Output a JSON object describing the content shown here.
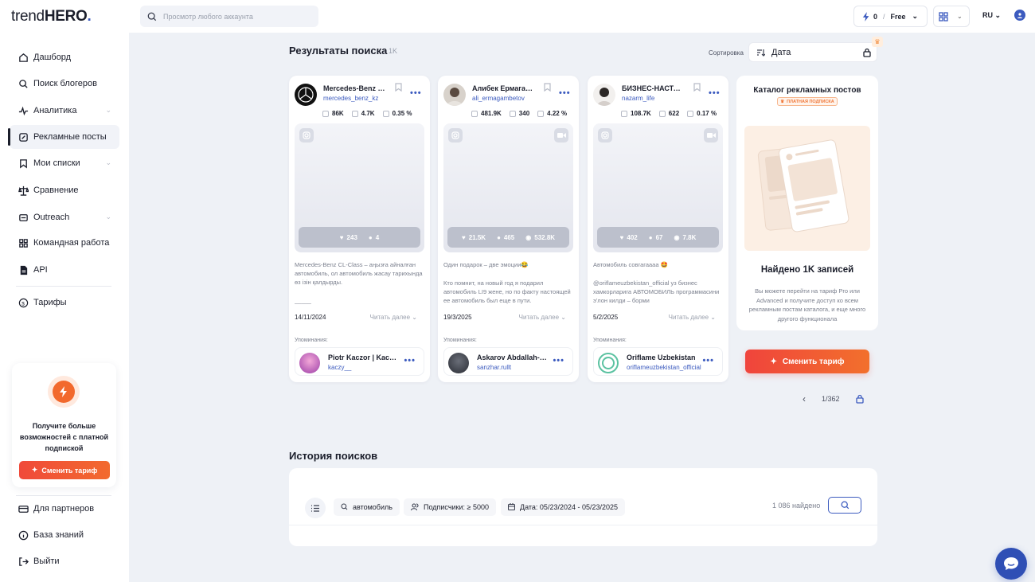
{
  "brand": {
    "prefix": "trend",
    "suffix": "HERO",
    "accent": "#3c5bbf",
    "cta": "#f04a3a"
  },
  "nav": [
    {
      "label": "Дашборд",
      "icon": "home-icon"
    },
    {
      "label": "Поиск блогеров",
      "icon": "search-icon"
    },
    {
      "label": "Аналитика",
      "icon": "analytics-icon"
    },
    {
      "label": "Рекламные посты",
      "icon": "ad-post-icon"
    },
    {
      "label": "Мои списки",
      "icon": "bookmark-icon"
    },
    {
      "label": "Сравнение",
      "icon": "scales-icon"
    },
    {
      "label": "Outreach",
      "icon": "outreach-icon"
    },
    {
      "label": "Командная работа",
      "icon": "grid-icon"
    },
    {
      "label": "API",
      "icon": "document-icon"
    },
    {
      "label": "Тарифы",
      "icon": "dollar-icon"
    }
  ],
  "promo": {
    "text": "Получите больше возможностей с платной подпиской",
    "button": "Сменить тариф"
  },
  "bottom_nav": [
    {
      "label": "Для партнеров",
      "icon": "card-icon"
    },
    {
      "label": "База знаний",
      "icon": "info-icon"
    },
    {
      "label": "Выйти",
      "icon": "logout-icon"
    }
  ],
  "topbar": {
    "search_placeholder": "Просмотр любого аккаунта",
    "credits": "0",
    "sep": "/",
    "plan": "Free",
    "lang": "RU"
  },
  "results": {
    "title": "Результаты поиска",
    "count": "1K",
    "sort_label": "Сортировка",
    "sort_value": "Дата"
  },
  "cards": [
    {
      "name": "Mercedes-Benz Kazakhstan",
      "handle": "mercedes_benz_kz",
      "followers": "86K",
      "posts": "4.7K",
      "er": "0.35 %",
      "likes": "243",
      "comments": "4",
      "views": "",
      "video": false,
      "desc": "Mercedes-Benz CL-Class – аңызға айналған автомобиль, ол автомобиль жасау тарихында өз ізін қалдырды.",
      "desc_extra": "_____",
      "date": "14/11/2024",
      "read_more": "Читать далее",
      "mention_label": "Упоминания:",
      "mention_name": "Piotr Kaczor | Kaczy __",
      "mention_handle": "kaczy__"
    },
    {
      "name": "Алибек Ермагамбетов",
      "handle": "ali_ermagambetov",
      "followers": "481.9K",
      "posts": "340",
      "er": "4.22 %",
      "likes": "21.5K",
      "comments": "465",
      "views": "532.8K",
      "video": true,
      "desc": "Один подарок – две эмоции😂",
      "desc_extra": "Кто помнит, на новый год я подарил автомобиль LI9 жене, но по факту настоящей ее автомобиль был еще в пути.",
      "date": "19/3/2025",
      "read_more": "Читать далее",
      "mention_label": "Упоминания:",
      "mention_name": "Askarov Abdallah-Sanzhar",
      "mention_handle": "sanzhar.rullt"
    },
    {
      "name": "БИЗНЕС-НАСТАВНИК",
      "handle": "nazarm_life",
      "followers": "108.7K",
      "posts": "622",
      "er": "0.17 %",
      "likes": "402",
      "comments": "67",
      "views": "7.8K",
      "video": true,
      "desc": "Автомобиль совгагаааа 🤩",
      "desc_extra": "@oriflameuzbekistan_official уз бизнес хамкорларига АВТОМОБИЛЬ программасини э'лон килди – борми",
      "date": "5/2/2025",
      "read_more": "Читать далее",
      "mention_label": "Упоминания:",
      "mention_name": "Oriflame Uzbekistan",
      "mention_handle": "oriflameuzbekistan_official"
    }
  ],
  "catalog": {
    "title": "Каталог рекламных постов",
    "badge": "ПЛАТНАЯ ПОДПИСКА",
    "found": "Найдено 1K записей",
    "desc": "Вы можете перейти на тариф Pro или Advanced и получите доступ ко всем рекламным постам каталога, и еще много другого функционала",
    "button": "Сменить тариф"
  },
  "pager": {
    "page": "1/362"
  },
  "history": {
    "title": "История поисков",
    "keyword": "автомобиль",
    "followers": "Подписчики: ≥ 5000",
    "dates": "Дата: 05/23/2024 - 05/23/2025",
    "found": "1 086 найдено"
  }
}
